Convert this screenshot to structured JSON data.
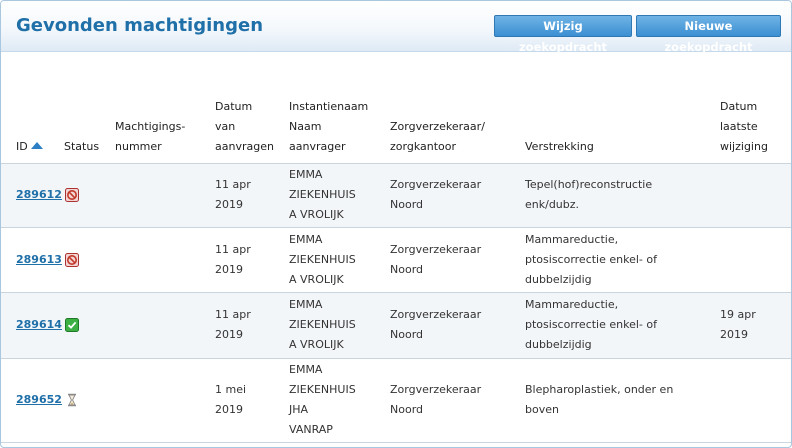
{
  "header": {
    "title": "Gevonden machtigingen",
    "edit_search_label": "Wijzig zoekopdracht",
    "new_search_label": "Nieuwe zoekopdracht"
  },
  "columns": {
    "id": "ID",
    "status": "Status",
    "machtigingsnummer_1": "Machtigings-",
    "machtigingsnummer_2": "nummer",
    "datum_aanvragen_1": "Datum",
    "datum_aanvragen_2": "van",
    "datum_aanvragen_3": "aanvragen",
    "instantie_1": "Instantienaam",
    "instantie_2": "Naam",
    "instantie_3": "aanvrager",
    "zorgverzekeraar_1": "Zorgverzekeraar/",
    "zorgverzekeraar_2": "zorgkantoor",
    "verstrekking": "Verstrekking",
    "laatste_wijziging_1": "Datum",
    "laatste_wijziging_2": "laatste",
    "laatste_wijziging_3": "wijziging"
  },
  "rows": [
    {
      "id": "289612",
      "status_icon": "rejected-icon",
      "date": [
        "11 apr",
        "2019"
      ],
      "instantie": [
        "EMMA",
        "ZIEKENHUIS",
        "A VROLIJK"
      ],
      "verzekeraar": [
        "Zorgverzekeraar",
        "Noord"
      ],
      "verstrekking": [
        "Tepel(hof)reconstructie",
        "enk/dubz."
      ],
      "last_changed": [
        "",
        ""
      ]
    },
    {
      "id": "289613",
      "status_icon": "rejected-icon",
      "date": [
        "11 apr",
        "2019"
      ],
      "instantie": [
        "EMMA",
        "ZIEKENHUIS",
        "A VROLIJK"
      ],
      "verzekeraar": [
        "Zorgverzekeraar",
        "Noord"
      ],
      "verstrekking": [
        "Mammareductie,",
        "ptosiscorrectie enkel- of",
        "dubbelzijdig"
      ],
      "last_changed": [
        "",
        ""
      ]
    },
    {
      "id": "289614",
      "status_icon": "approved-icon",
      "date": [
        "11 apr",
        "2019"
      ],
      "instantie": [
        "EMMA",
        "ZIEKENHUIS",
        "A VROLIJK"
      ],
      "verzekeraar": [
        "Zorgverzekeraar",
        "Noord"
      ],
      "verstrekking": [
        "Mammareductie,",
        "ptosiscorrectie enkel- of",
        "dubbelzijdig"
      ],
      "last_changed": [
        "19 apr",
        "2019"
      ]
    },
    {
      "id": "289652",
      "status_icon": "pending-hourglass-icon",
      "date": [
        "1 mei",
        "2019"
      ],
      "instantie": [
        "EMMA",
        "ZIEKENHUIS",
        "JHA",
        "VANRAP"
      ],
      "verzekeraar": [
        "Zorgverzekeraar",
        "Noord"
      ],
      "verstrekking": [
        "Blepharoplastiek, onder en",
        "boven"
      ],
      "last_changed": [
        "",
        ""
      ]
    }
  ],
  "colors": {
    "title": "#1f6fa8",
    "button": "#3b8fd2",
    "link": "#1f6fa8",
    "rejected": "#c0392b",
    "approved": "#2e9e3a"
  }
}
